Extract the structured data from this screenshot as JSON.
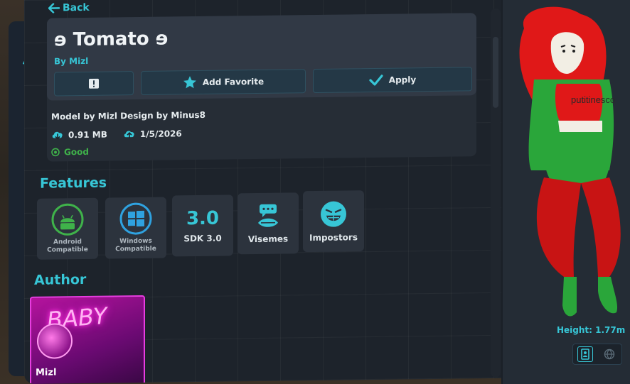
{
  "nav": {
    "back_label": "Back"
  },
  "avatar": {
    "title": "ɘ Tomato ɘ",
    "author_line": "By Mizl",
    "credit": "Model by Mizl Design by Minus8",
    "file_size": "0.91 MB",
    "upload_date": "1/5/2026",
    "performance": "Good"
  },
  "actions": {
    "report_icon": "!",
    "favorite_label": "Add Favorite",
    "apply_label": "Apply"
  },
  "features": {
    "title": "Features",
    "items": [
      {
        "label": "Android Compatible",
        "icon": "android-icon"
      },
      {
        "label": "Windows Compatible",
        "icon": "windows-icon"
      },
      {
        "icon_text": "3.0",
        "label": "SDK 3.0",
        "icon": "sdk-icon"
      },
      {
        "label": "Visemes",
        "icon": "visemes-icon"
      },
      {
        "label": "Impostors",
        "icon": "impostors-icon"
      }
    ]
  },
  "author": {
    "title": "Author",
    "name": "Mizl",
    "banner_text": "BABY"
  },
  "preview": {
    "height_label": "Height: 1.77m",
    "shirt_text": "putitinesco"
  },
  "colors": {
    "accent": "#37c6d6",
    "good": "#3fb24a",
    "panel": "#1d232b",
    "author_card": "#b5139e"
  }
}
